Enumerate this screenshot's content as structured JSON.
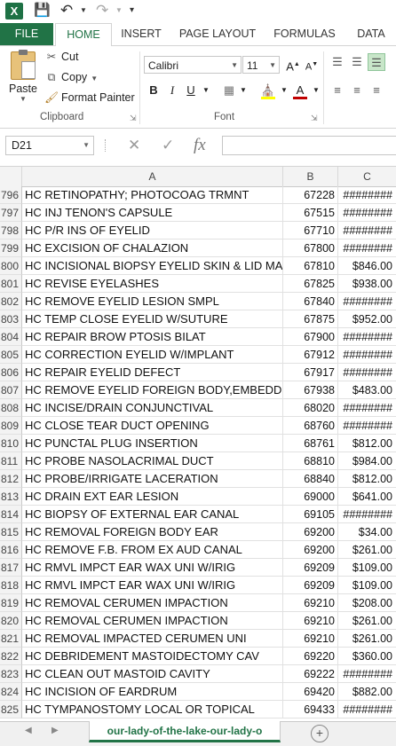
{
  "quick_access": {
    "logo": "X",
    "save_icon": "save-icon",
    "undo_icon": "undo-icon",
    "redo_icon": "redo-icon"
  },
  "tabs": [
    "FILE",
    "HOME",
    "INSERT",
    "PAGE LAYOUT",
    "FORMULAS",
    "DATA"
  ],
  "ribbon": {
    "paste": "Paste",
    "cut": "Cut",
    "copy": "Copy",
    "format_painter": "Format Painter",
    "clipboard_label": "Clipboard",
    "font_name": "Calibri",
    "font_size": "11",
    "font_label": "Font",
    "bold": "B",
    "italic": "I",
    "underline": "U",
    "font_color": "#c00000",
    "fill_color": "#ffff00"
  },
  "formula_bar": {
    "name_box": "D21",
    "formula": ""
  },
  "columns": [
    "A",
    "B",
    "C"
  ],
  "rows": [
    {
      "n": "796",
      "a": "HC RETINOPATHY; PHOTOCOAG TRMNT",
      "b": "67228",
      "c": "########"
    },
    {
      "n": "797",
      "a": "HC INJ TENON'S CAPSULE",
      "b": "67515",
      "c": "########"
    },
    {
      "n": "798",
      "a": "HC P/R INS OF EYELID",
      "b": "67710",
      "c": "########"
    },
    {
      "n": "799",
      "a": "HC EXCISION OF CHALAZION",
      "b": "67800",
      "c": "########"
    },
    {
      "n": "800",
      "a": "HC INCISIONAL BIOPSY EYELID SKIN & LID MARG",
      "b": "67810",
      "c": "$846.00"
    },
    {
      "n": "801",
      "a": "HC REVISE EYELASHES",
      "b": "67825",
      "c": "$938.00"
    },
    {
      "n": "802",
      "a": "HC REMOVE EYELID LESION SMPL",
      "b": "67840",
      "c": "########"
    },
    {
      "n": "803",
      "a": "HC TEMP CLOSE EYELID W/SUTURE",
      "b": "67875",
      "c": "$952.00"
    },
    {
      "n": "804",
      "a": "HC REPAIR BROW PTOSIS BILAT",
      "b": "67900",
      "c": "########"
    },
    {
      "n": "805",
      "a": "HC CORRECTION EYELID W/IMPLANT",
      "b": "67912",
      "c": "########"
    },
    {
      "n": "806",
      "a": "HC REPAIR EYELID DEFECT",
      "b": "67917",
      "c": "########"
    },
    {
      "n": "807",
      "a": "HC REMOVE EYELID FOREIGN BODY,EMBEDDED",
      "b": "67938",
      "c": "$483.00"
    },
    {
      "n": "808",
      "a": "HC INCISE/DRAIN CONJUNCTIVAL",
      "b": "68020",
      "c": "########"
    },
    {
      "n": "809",
      "a": "HC CLOSE TEAR DUCT OPENING",
      "b": "68760",
      "c": "########"
    },
    {
      "n": "810",
      "a": "HC PUNCTAL PLUG INSERTION",
      "b": "68761",
      "c": "$812.00"
    },
    {
      "n": "811",
      "a": "HC PROBE NASOLACRIMAL DUCT",
      "b": "68810",
      "c": "$984.00"
    },
    {
      "n": "812",
      "a": "HC PROBE/IRRIGATE LACERATION",
      "b": "68840",
      "c": "$812.00"
    },
    {
      "n": "813",
      "a": "HC DRAIN EXT EAR LESION",
      "b": "69000",
      "c": "$641.00"
    },
    {
      "n": "814",
      "a": "HC BIOPSY OF EXTERNAL EAR CANAL",
      "b": "69105",
      "c": "########"
    },
    {
      "n": "815",
      "a": "HC REMOVAL FOREIGN BODY EAR",
      "b": "69200",
      "c": "$34.00"
    },
    {
      "n": "816",
      "a": "HC REMOVE F.B. FROM EX AUD CANAL",
      "b": "69200",
      "c": "$261.00"
    },
    {
      "n": "817",
      "a": "HC RMVL IMPCT EAR WAX UNI W/IRIG",
      "b": "69209",
      "c": "$109.00"
    },
    {
      "n": "818",
      "a": "HC RMVL IMPCT EAR WAX UNI W/IRIG",
      "b": "69209",
      "c": "$109.00"
    },
    {
      "n": "819",
      "a": "HC REMOVAL CERUMEN IMPACTION",
      "b": "69210",
      "c": "$208.00"
    },
    {
      "n": "820",
      "a": "HC REMOVAL CERUMEN IMPACTION",
      "b": "69210",
      "c": "$261.00"
    },
    {
      "n": "821",
      "a": "HC REMOVAL IMPACTED CERUMEN UNI",
      "b": "69210",
      "c": "$261.00"
    },
    {
      "n": "822",
      "a": "HC DEBRIDEMENT  MASTOIDECTOMY CAV",
      "b": "69220",
      "c": "$360.00"
    },
    {
      "n": "823",
      "a": "HC CLEAN OUT MASTOID CAVITY",
      "b": "69222",
      "c": "########"
    },
    {
      "n": "824",
      "a": "HC INCISION OF EARDRUM",
      "b": "69420",
      "c": "$882.00"
    },
    {
      "n": "825",
      "a": "HC TYMPANOSTOMY LOCAL OR TOPICAL",
      "b": "69433",
      "c": "########"
    }
  ],
  "sheet_tab": "our-lady-of-the-lake-our-lady-o",
  "accent_color": "#217346"
}
